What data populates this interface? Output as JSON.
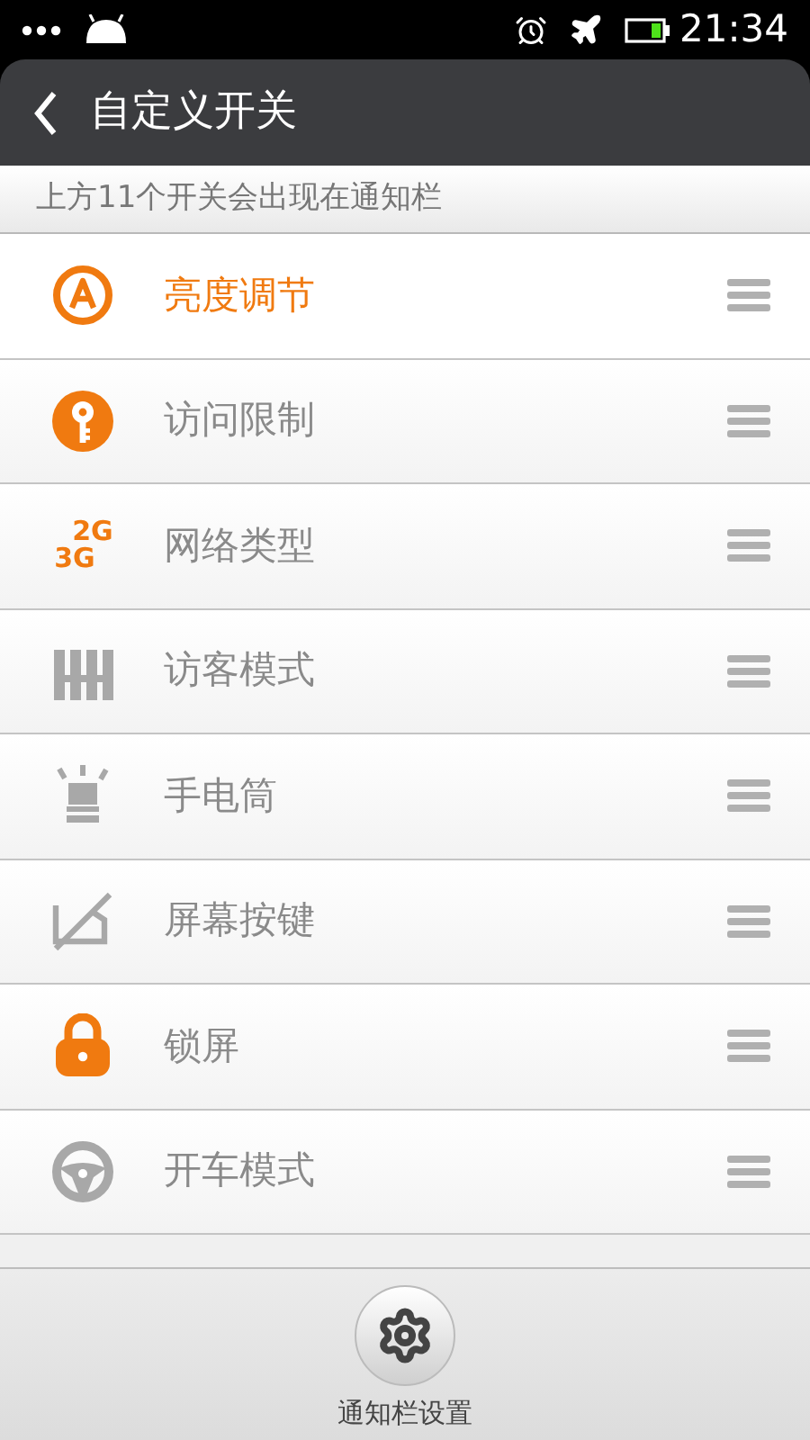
{
  "status_bar": {
    "time": "21:34"
  },
  "header": {
    "title": "自定义开关"
  },
  "notice": "上方11个开关会出现在通知栏",
  "toggles": [
    {
      "kind": "brightness",
      "label": "亮度调节",
      "on": true,
      "selected": true
    },
    {
      "kind": "key",
      "label": "访问限制",
      "on": true,
      "selected": false
    },
    {
      "kind": "network",
      "label": "网络类型",
      "on": true,
      "selected": false,
      "icon_text": [
        "2G",
        "3G"
      ]
    },
    {
      "kind": "fence",
      "label": "访客模式",
      "on": false,
      "selected": false
    },
    {
      "kind": "flashlight",
      "label": "手电筒",
      "on": false,
      "selected": false
    },
    {
      "kind": "screen-keys",
      "label": "屏幕按键",
      "on": false,
      "selected": false
    },
    {
      "kind": "lock",
      "label": "锁屏",
      "on": true,
      "selected": false
    },
    {
      "kind": "steering",
      "label": "开车模式",
      "on": false,
      "selected": false
    }
  ],
  "footer": {
    "button_label": "通知栏设置"
  }
}
